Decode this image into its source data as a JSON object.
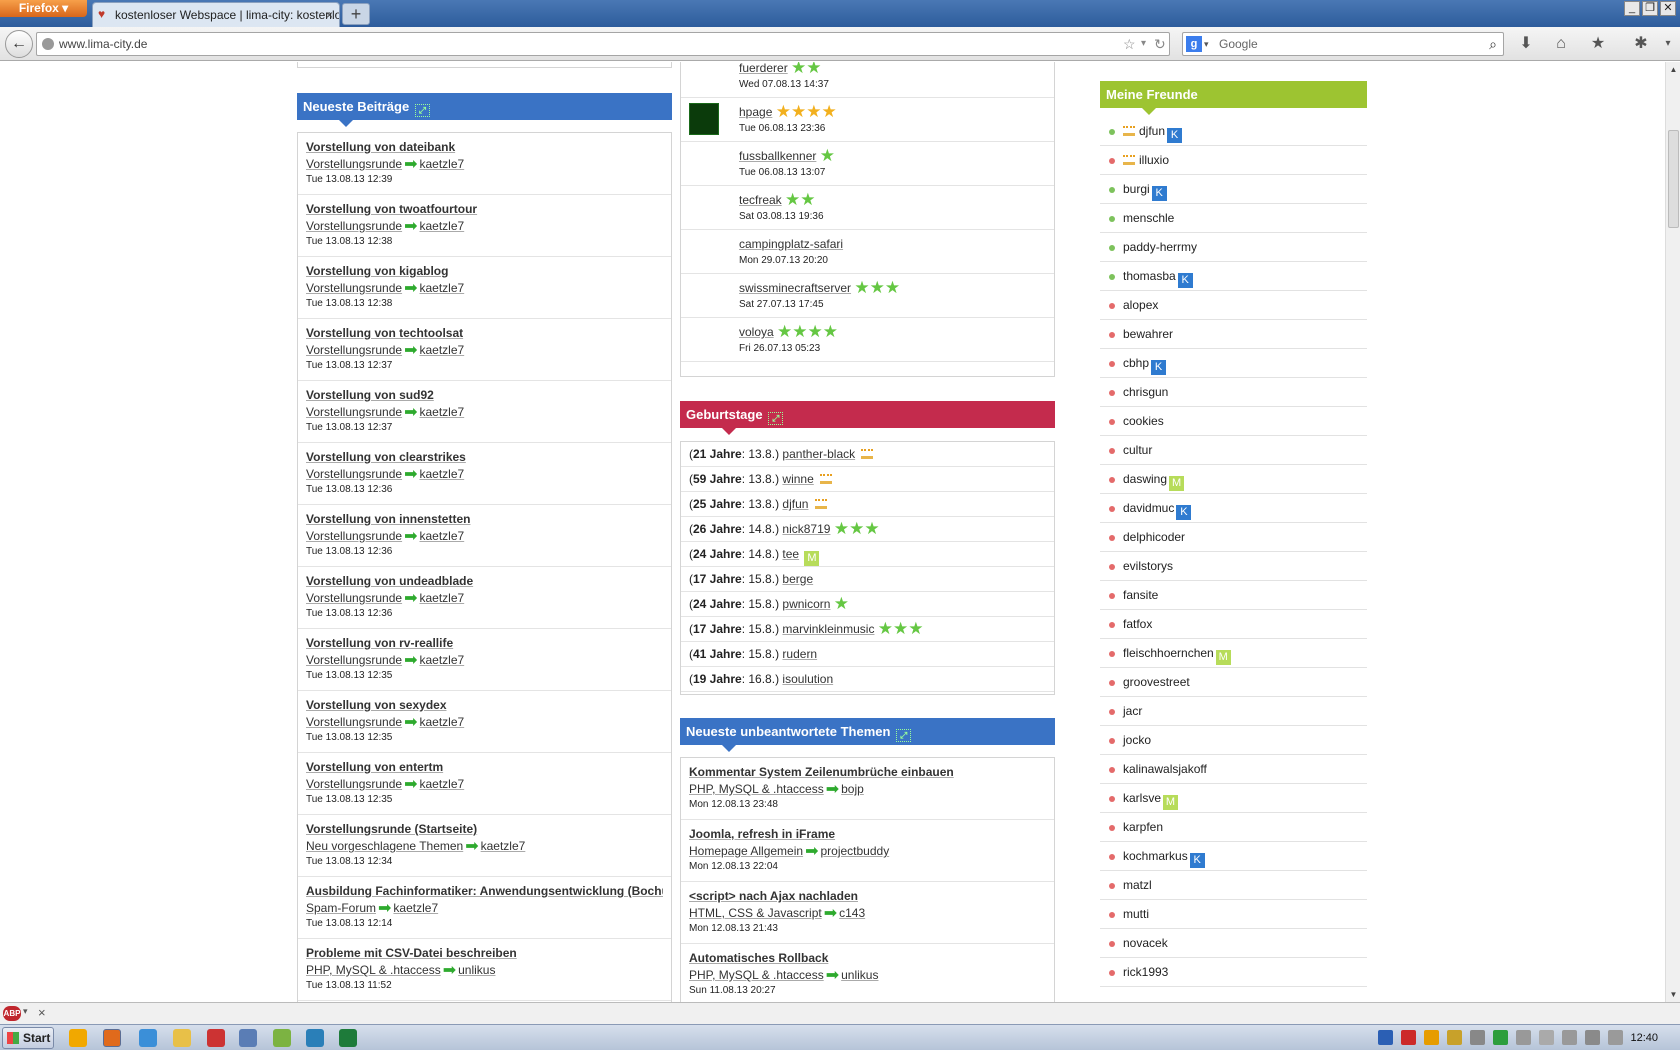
{
  "browser": {
    "menu_button": "Firefox",
    "tab_title": "kostenloser Webspace | lima-city: kostenlos...",
    "url": "www.lima-city.de",
    "search_placeholder": "Google",
    "search_engine_letter": "g"
  },
  "panels": {
    "posts_header": "Neueste Beiträge",
    "birthdays_header": "Geburtstage",
    "unanswered_header": "Neueste unbeantwortete Themen",
    "friends_header": "Meine Freunde"
  },
  "posts": [
    {
      "title": "Vorstellung von dateibank",
      "forum": "Vorstellungsrunde",
      "user": "kaetzle7",
      "date": "Tue 13.08.13 12:39"
    },
    {
      "title": "Vorstellung von twoatfourtour",
      "forum": "Vorstellungsrunde",
      "user": "kaetzle7",
      "date": "Tue 13.08.13 12:38"
    },
    {
      "title": "Vorstellung von kigablog",
      "forum": "Vorstellungsrunde",
      "user": "kaetzle7",
      "date": "Tue 13.08.13 12:38"
    },
    {
      "title": "Vorstellung von techtoolsat",
      "forum": "Vorstellungsrunde",
      "user": "kaetzle7",
      "date": "Tue 13.08.13 12:37"
    },
    {
      "title": "Vorstellung von sud92",
      "forum": "Vorstellungsrunde",
      "user": "kaetzle7",
      "date": "Tue 13.08.13 12:37"
    },
    {
      "title": "Vorstellung von clearstrikes",
      "forum": "Vorstellungsrunde",
      "user": "kaetzle7",
      "date": "Tue 13.08.13 12:36"
    },
    {
      "title": "Vorstellung von innenstetten",
      "forum": "Vorstellungsrunde",
      "user": "kaetzle7",
      "date": "Tue 13.08.13 12:36"
    },
    {
      "title": "Vorstellung von undeadblade",
      "forum": "Vorstellungsrunde",
      "user": "kaetzle7",
      "date": "Tue 13.08.13 12:36"
    },
    {
      "title": "Vorstellung von rv-reallife",
      "forum": "Vorstellungsrunde",
      "user": "kaetzle7",
      "date": "Tue 13.08.13 12:35"
    },
    {
      "title": "Vorstellung von sexydex",
      "forum": "Vorstellungsrunde",
      "user": "kaetzle7",
      "date": "Tue 13.08.13 12:35"
    },
    {
      "title": "Vorstellung von entertm",
      "forum": "Vorstellungsrunde",
      "user": "kaetzle7",
      "date": "Tue 13.08.13 12:35"
    },
    {
      "title": "Vorstellungsrunde (Startseite)",
      "forum": "Neu vorgeschlagene Themen",
      "user": "kaetzle7",
      "date": "Tue 13.08.13 12:34"
    },
    {
      "title": "Ausbildung Fachinformatiker: Anwendungsentwicklung (Bochum)",
      "forum": "Spam-Forum",
      "user": "kaetzle7",
      "date": "Tue 13.08.13 12:14"
    },
    {
      "title": "Probleme mit CSV-Datei beschreiben",
      "forum": "PHP, MySQL & .htaccess",
      "user": "unlikus",
      "date": "Tue 13.08.13 11:52"
    }
  ],
  "new_users": [
    {
      "name": "fuerderer",
      "date": "Wed 07.08.13 14:37",
      "stars": 2,
      "gold": false,
      "avatar": false
    },
    {
      "name": "hpage",
      "date": "Tue 06.08.13 23:36",
      "stars": 4,
      "gold": true,
      "avatar": true
    },
    {
      "name": "fussballkenner",
      "date": "Tue 06.08.13 13:07",
      "stars": 1,
      "gold": false,
      "avatar": false
    },
    {
      "name": "tecfreak",
      "date": "Sat 03.08.13 19:36",
      "stars": 2,
      "gold": false,
      "avatar": false
    },
    {
      "name": "campingplatz-safari",
      "date": "Mon 29.07.13 20:20",
      "stars": 0,
      "gold": false,
      "avatar": false
    },
    {
      "name": "swissminecraftserver",
      "date": "Sat 27.07.13 17:45",
      "stars": 3,
      "gold": false,
      "avatar": false
    },
    {
      "name": "voloya",
      "date": "Fri 26.07.13 05:23",
      "stars": 4,
      "gold": false,
      "avatar": false
    }
  ],
  "birthdays": [
    {
      "age": "21 Jahre",
      "date": "13.8.",
      "user": "panther-black",
      "extra": "cake"
    },
    {
      "age": "59 Jahre",
      "date": "13.8.",
      "user": "winne",
      "extra": "cake"
    },
    {
      "age": "25 Jahre",
      "date": "13.8.",
      "user": "djfun",
      "extra": "cake"
    },
    {
      "age": "26 Jahre",
      "date": "14.8.",
      "user": "nick8719",
      "extra": "stars3"
    },
    {
      "age": "24 Jahre",
      "date": "14.8.",
      "user": "tee",
      "extra": "M"
    },
    {
      "age": "17 Jahre",
      "date": "15.8.",
      "user": "berge",
      "extra": ""
    },
    {
      "age": "24 Jahre",
      "date": "15.8.",
      "user": "pwnicorn",
      "extra": "stars1"
    },
    {
      "age": "17 Jahre",
      "date": "15.8.",
      "user": "marvinkleinmusic",
      "extra": "stars3"
    },
    {
      "age": "41 Jahre",
      "date": "15.8.",
      "user": "rudern",
      "extra": ""
    },
    {
      "age": "19 Jahre",
      "date": "16.8.",
      "user": "isoulution",
      "extra": ""
    }
  ],
  "unanswered": [
    {
      "title": "Kommentar System Zeilenumbrüche einbauen",
      "forum": "PHP, MySQL & .htaccess",
      "user": "bojp",
      "date": "Mon 12.08.13 23:48"
    },
    {
      "title": "Joomla, refresh in iFrame",
      "forum": "Homepage Allgemein",
      "user": "projectbuddy",
      "date": "Mon 12.08.13 22:04"
    },
    {
      "title": "<script> nach Ajax nachladen",
      "forum": "HTML, CSS & Javascript",
      "user": "c143",
      "date": "Mon 12.08.13 21:43"
    },
    {
      "title": "Automatisches Rollback",
      "forum": "PHP, MySQL & .htaccess",
      "user": "unlikus",
      "date": "Sun 11.08.13 20:27"
    }
  ],
  "friends": [
    {
      "name": "djfun",
      "online": true,
      "cake": true,
      "badge": "K"
    },
    {
      "name": "illuxio",
      "online": false,
      "cake": true,
      "badge": ""
    },
    {
      "name": "burgi",
      "online": true,
      "cake": false,
      "badge": "K"
    },
    {
      "name": "menschle",
      "online": true,
      "cake": false,
      "badge": ""
    },
    {
      "name": "paddy-herrmy",
      "online": true,
      "cake": false,
      "badge": ""
    },
    {
      "name": "thomasba",
      "online": true,
      "cake": false,
      "badge": "K"
    },
    {
      "name": "alopex",
      "online": false,
      "cake": false,
      "badge": ""
    },
    {
      "name": "bewahrer",
      "online": false,
      "cake": false,
      "badge": ""
    },
    {
      "name": "cbhp",
      "online": false,
      "cake": false,
      "badge": "K"
    },
    {
      "name": "chrisgun",
      "online": false,
      "cake": false,
      "badge": ""
    },
    {
      "name": "cookies",
      "online": false,
      "cake": false,
      "badge": ""
    },
    {
      "name": "cultur",
      "online": false,
      "cake": false,
      "badge": ""
    },
    {
      "name": "daswing",
      "online": false,
      "cake": false,
      "badge": "M"
    },
    {
      "name": "davidmuc",
      "online": false,
      "cake": false,
      "badge": "K"
    },
    {
      "name": "delphicoder",
      "online": false,
      "cake": false,
      "badge": ""
    },
    {
      "name": "evilstorys",
      "online": false,
      "cake": false,
      "badge": ""
    },
    {
      "name": "fansite",
      "online": false,
      "cake": false,
      "badge": ""
    },
    {
      "name": "fatfox",
      "online": false,
      "cake": false,
      "badge": ""
    },
    {
      "name": "fleischhoernchen",
      "online": false,
      "cake": false,
      "badge": "M"
    },
    {
      "name": "groovestreet",
      "online": false,
      "cake": false,
      "badge": ""
    },
    {
      "name": "jacr",
      "online": false,
      "cake": false,
      "badge": ""
    },
    {
      "name": "jocko",
      "online": false,
      "cake": false,
      "badge": ""
    },
    {
      "name": "kalinawalsjakoff",
      "online": false,
      "cake": false,
      "badge": ""
    },
    {
      "name": "karlsve",
      "online": false,
      "cake": false,
      "badge": "M"
    },
    {
      "name": "karpfen",
      "online": false,
      "cake": false,
      "badge": ""
    },
    {
      "name": "kochmarkus",
      "online": false,
      "cake": false,
      "badge": "K"
    },
    {
      "name": "matzl",
      "online": false,
      "cake": false,
      "badge": ""
    },
    {
      "name": "mutti",
      "online": false,
      "cake": false,
      "badge": ""
    },
    {
      "name": "novacek",
      "online": false,
      "cake": false,
      "badge": ""
    },
    {
      "name": "rick1993",
      "online": false,
      "cake": false,
      "badge": ""
    }
  ],
  "taskbar": {
    "start": "Start",
    "clock": "12:40"
  },
  "addon_bar": {
    "abp_label": "ABP"
  }
}
